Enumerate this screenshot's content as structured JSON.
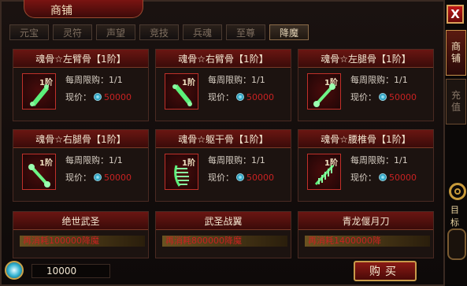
{
  "window": {
    "title": "商铺",
    "close_label": "X"
  },
  "side_tabs": [
    {
      "label": "商铺",
      "chars": [
        "商",
        "铺"
      ],
      "active": true
    },
    {
      "label": "充值",
      "chars": [
        "充",
        "值"
      ],
      "active": false
    }
  ],
  "side_panel": {
    "label": "目标"
  },
  "categories": [
    {
      "label": "元宝",
      "active": false
    },
    {
      "label": "灵符",
      "active": false
    },
    {
      "label": "声望",
      "active": false
    },
    {
      "label": "竞技",
      "active": false
    },
    {
      "label": "兵魂",
      "active": false
    },
    {
      "label": "至尊",
      "active": false
    },
    {
      "label": "降魔",
      "active": true
    }
  ],
  "items": [
    {
      "name": "魂骨☆左臂骨【1阶】",
      "tier": "1阶",
      "limit": "每周限购：1/1",
      "price_label": "现价：",
      "price": "50000",
      "icon": "bone-arm-icon"
    },
    {
      "name": "魂骨☆右臂骨【1阶】",
      "tier": "1阶",
      "limit": "每周限购：1/1",
      "price_label": "现价：",
      "price": "50000",
      "icon": "bone-arm-icon"
    },
    {
      "name": "魂骨☆左腿骨【1阶】",
      "tier": "1阶",
      "limit": "每周限购：1/1",
      "price_label": "现价：",
      "price": "50000",
      "icon": "bone-leg-icon"
    },
    {
      "name": "魂骨☆右腿骨【1阶】",
      "tier": "1阶",
      "limit": "每周限购：1/1",
      "price_label": "现价：",
      "price": "50000",
      "icon": "bone-leg-icon"
    },
    {
      "name": "魂骨☆躯干骨【1阶】",
      "tier": "1阶",
      "limit": "每周限购：1/1",
      "price_label": "现价：",
      "price": "50000",
      "icon": "bone-torso-icon"
    },
    {
      "name": "魂骨☆腰椎骨【1阶】",
      "tier": "1阶",
      "limit": "每周限购：1/1",
      "price_label": "现价：",
      "price": "50000",
      "icon": "bone-spine-icon"
    }
  ],
  "bottom_items": [
    {
      "name": "绝世武圣",
      "sub": "再消耗100000降魔"
    },
    {
      "name": "武圣战翼",
      "sub": "再消耗800000降魔"
    },
    {
      "name": "青龙偃月刀",
      "sub": "再消耗1400000降"
    }
  ],
  "footer": {
    "balance": "10000",
    "buy_label": "购买"
  },
  "colors": {
    "accent": "#6a1612",
    "price": "#c82222",
    "border_gold": "#c89a4a"
  }
}
